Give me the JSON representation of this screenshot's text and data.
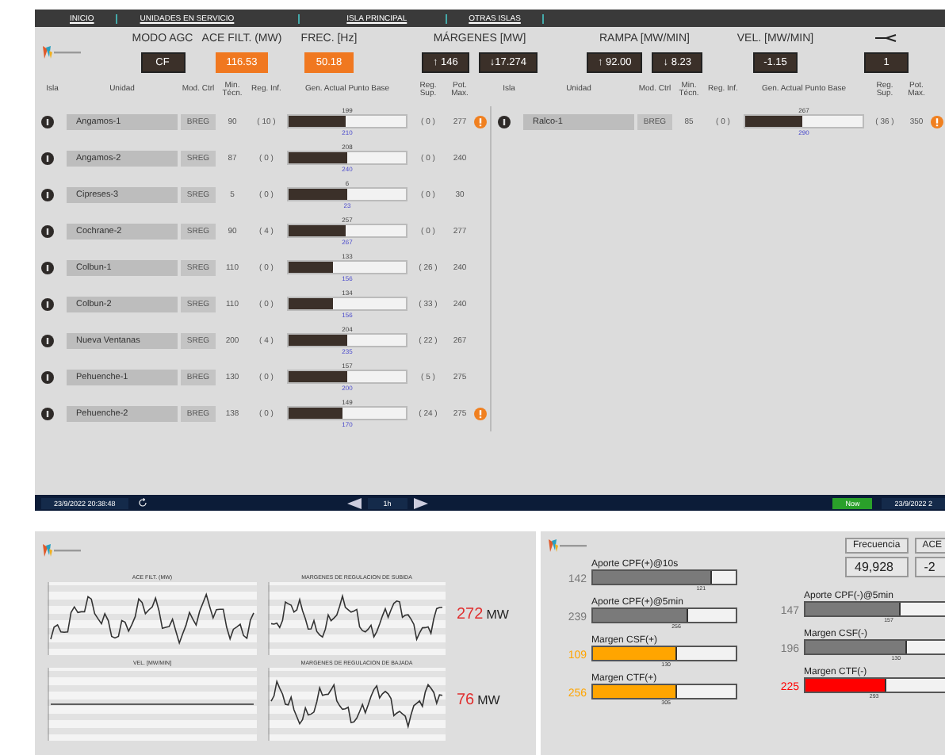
{
  "nav": [
    {
      "label": "INICIO"
    },
    {
      "label": "UNIDADES EN SERVICIO"
    },
    {
      "label": "ISLA PRINCIPAL"
    },
    {
      "label": "OTRAS ISLAS"
    }
  ],
  "indicators": [
    {
      "kind": "text",
      "label": "MODO AGC",
      "values": [
        {
          "text": "CF",
          "alert": false
        }
      ]
    },
    {
      "kind": "text",
      "label": "ACE FILT. (MW)",
      "values": [
        {
          "text": "116.53",
          "alert": true
        }
      ]
    },
    {
      "kind": "text",
      "label": "FREC. [Hz]",
      "values": [
        {
          "text": "50.18",
          "alert": true
        }
      ]
    },
    {
      "kind": "text",
      "label": "MÁRGENES [MW]",
      "values": [
        {
          "text": "↑ 146",
          "alert": false
        },
        {
          "text": "↓17.274",
          "alert": false
        }
      ]
    },
    {
      "kind": "text",
      "label": "RAMPA [MW/MIN]",
      "values": [
        {
          "text": "↑ 92.00",
          "alert": false
        },
        {
          "text": "↓ 8.23",
          "alert": false
        }
      ]
    },
    {
      "kind": "text",
      "label": "VEL. [MW/MIN]",
      "values": [
        {
          "text": "-1.15",
          "alert": false
        }
      ]
    },
    {
      "kind": "icon",
      "values": [
        {
          "text": "1",
          "alert": false
        }
      ]
    }
  ],
  "tables": [
    {
      "columns": [
        "Isla",
        "Unidad",
        "Mod. Ctrl",
        "Min. Técn.",
        "Reg. Inf.",
        "Gen. Actual Punto Base",
        "Reg. Sup.",
        "Pot. Max."
      ],
      "rows": [
        {
          "unit": "Angamos-1",
          "mode": "BREG",
          "min": "90",
          "reg_inf": "( 10 )",
          "gen": "199",
          "base": "210",
          "level": 0.48,
          "reg_sup": "( 0 )",
          "pot_max": "277",
          "flag": true
        },
        {
          "unit": "Angamos-2",
          "mode": "SREG",
          "min": "87",
          "reg_inf": "( 0 )",
          "gen": "208",
          "base": "240",
          "level": 0.5,
          "reg_sup": "( 0 )",
          "pot_max": "240",
          "flag": false
        },
        {
          "unit": "Cipreses-3",
          "mode": "SREG",
          "min": "5",
          "reg_inf": "( 0 )",
          "gen": "6",
          "base": "23",
          "level": 0.5,
          "reg_sup": "( 0 )",
          "pot_max": "30",
          "flag": false
        },
        {
          "unit": "Cochrane-2",
          "mode": "SREG",
          "min": "90",
          "reg_inf": "( 4 )",
          "gen": "257",
          "base": "267",
          "level": 0.48,
          "reg_sup": "( 0 )",
          "pot_max": "277",
          "flag": false
        },
        {
          "unit": "Colbun-1",
          "mode": "SREG",
          "min": "110",
          "reg_inf": "( 0 )",
          "gen": "133",
          "base": "156",
          "level": 0.38,
          "reg_sup": "( 26 )",
          "pot_max": "240",
          "flag": false
        },
        {
          "unit": "Colbun-2",
          "mode": "SREG",
          "min": "110",
          "reg_inf": "( 0 )",
          "gen": "134",
          "base": "156",
          "level": 0.38,
          "reg_sup": "( 33 )",
          "pot_max": "240",
          "flag": false
        },
        {
          "unit": "Nueva Ventanas",
          "mode": "SREG",
          "min": "200",
          "reg_inf": "( 4 )",
          "gen": "204",
          "base": "235",
          "level": 0.5,
          "reg_sup": "( 22 )",
          "pot_max": "267",
          "flag": false
        },
        {
          "unit": "Pehuenche-1",
          "mode": "BREG",
          "min": "130",
          "reg_inf": "( 0 )",
          "gen": "157",
          "base": "200",
          "level": 0.5,
          "reg_sup": "( 5 )",
          "pot_max": "275",
          "flag": false
        },
        {
          "unit": "Pehuenche-2",
          "mode": "BREG",
          "min": "138",
          "reg_inf": "( 0 )",
          "gen": "149",
          "base": "170",
          "level": 0.46,
          "reg_sup": "( 24 )",
          "pot_max": "275",
          "flag": true
        }
      ]
    },
    {
      "columns": [
        "Isla",
        "Unidad",
        "Mod. Ctrl",
        "Min. Técn.",
        "Reg. Inf.",
        "Gen. Actual Punto Base",
        "Reg. Sup.",
        "Pot. Max."
      ],
      "rows": [
        {
          "unit": "Ralco-1",
          "mode": "BREG",
          "min": "85",
          "reg_inf": "( 0 )",
          "gen": "267",
          "base": "290",
          "level": 0.48,
          "reg_sup": "( 36 )",
          "pot_max": "350",
          "flag": true
        }
      ]
    }
  ],
  "time_bar": {
    "start": "23/9/2022 20:38:48",
    "period": "1h",
    "now": "Now",
    "end": "23/9/2022 2"
  },
  "trend_panel": {
    "charts": [
      {
        "title": "ACE FILT. (MW)",
        "kind": "wave"
      },
      {
        "title": "MARGENES DE REGULACION DE SUBIDA",
        "kind": "wave"
      },
      {
        "title": "VEL. [MW/MIN]",
        "kind": "flat"
      },
      {
        "title": "MARGENES DE REGULACION DE BAJADA",
        "kind": "wave"
      }
    ],
    "readings": [
      {
        "value": "272",
        "unit": "MW"
      },
      {
        "value": "76",
        "unit": "MW"
      }
    ]
  },
  "reserve_panel": {
    "frequency": {
      "label": "Frecuencia",
      "value": "49,928"
    },
    "ace": {
      "label": "ACE",
      "value": "-2"
    },
    "left": [
      {
        "label": "Aporte CPF(+)@10s",
        "value": "142",
        "color": "#7a7a7a",
        "level": 0.82,
        "mark": "121"
      },
      {
        "label": "Aporte CPF(+)@5min",
        "value": "239",
        "color": "#7a7a7a",
        "level": 0.65,
        "mark": "256"
      },
      {
        "label": "Margen CSF(+)",
        "value": "109",
        "color": "#ffa500",
        "level": 0.58,
        "mark": "130"
      },
      {
        "label": "Margen CTF(+)",
        "value": "256",
        "color": "#ffa500",
        "level": 0.58,
        "mark": "305"
      }
    ],
    "right": [
      {
        "label": "Aporte CPF(-)@5min",
        "value": "147",
        "color": "#7a7a7a",
        "level": 0.65,
        "mark": "157"
      },
      {
        "label": "Margen CSF(-)",
        "value": "196",
        "color": "#7a7a7a",
        "level": 0.7,
        "mark": "130"
      },
      {
        "label": "Margen CTF(-)",
        "value": "225",
        "color": "#ff0000",
        "level": 0.55,
        "mark": "293"
      }
    ]
  }
}
